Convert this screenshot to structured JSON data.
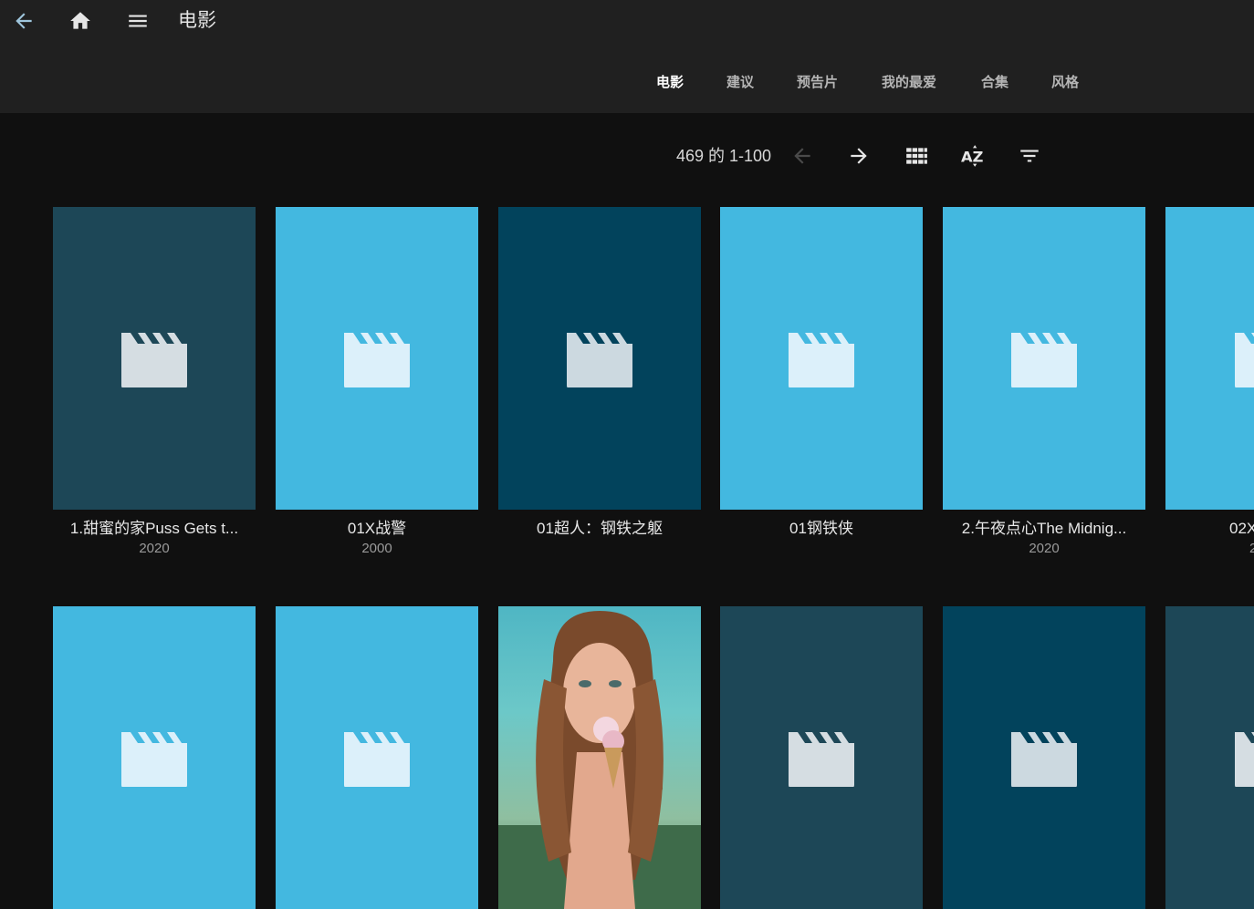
{
  "header": {
    "title": "电影",
    "tabs": [
      {
        "label": "电影",
        "active": true
      },
      {
        "label": "建议",
        "active": false
      },
      {
        "label": "预告片",
        "active": false
      },
      {
        "label": "我的最爱",
        "active": false
      },
      {
        "label": "合集",
        "active": false
      },
      {
        "label": "风格",
        "active": false
      }
    ]
  },
  "toolbar": {
    "count": "469 的 1-100"
  },
  "colors": {
    "header_bg": "#202020",
    "page_bg": "#101010",
    "poster_light": "#43b8e0",
    "poster_teal": "#1d4757",
    "poster_navy": "#02435c"
  },
  "movies_row1": [
    {
      "title": "1.甜蜜的家Puss Gets t...",
      "year": "2020",
      "color": "#1d4757",
      "icon": "clapperboard-icon"
    },
    {
      "title": "01X战警",
      "year": "2000",
      "color": "#43b8e0",
      "icon": "clapperboard-icon"
    },
    {
      "title": "01超人：钢铁之躯",
      "year": "",
      "color": "#02435c",
      "icon": "clapperboard-icon"
    },
    {
      "title": "01钢铁侠",
      "year": "",
      "color": "#43b8e0",
      "icon": "clapperboard-icon"
    },
    {
      "title": "2.午夜点心The Midnig...",
      "year": "2020",
      "color": "#43b8e0",
      "icon": "clapperboard-icon"
    },
    {
      "title": "02X",
      "year": "2",
      "color": "#43b8e0",
      "icon": "clapperboard-icon"
    }
  ],
  "movies_row2": [
    {
      "color": "#43b8e0",
      "icon": "clapperboard-icon"
    },
    {
      "color": "#43b8e0",
      "icon": "clapperboard-icon"
    },
    {
      "color": "photo",
      "icon": "poster-image"
    },
    {
      "color": "#1d4757",
      "icon": "clapperboard-icon"
    },
    {
      "color": "#02435c",
      "icon": "clapperboard-icon"
    },
    {
      "color": "#1d4757",
      "icon": "clapperboard-icon"
    }
  ]
}
